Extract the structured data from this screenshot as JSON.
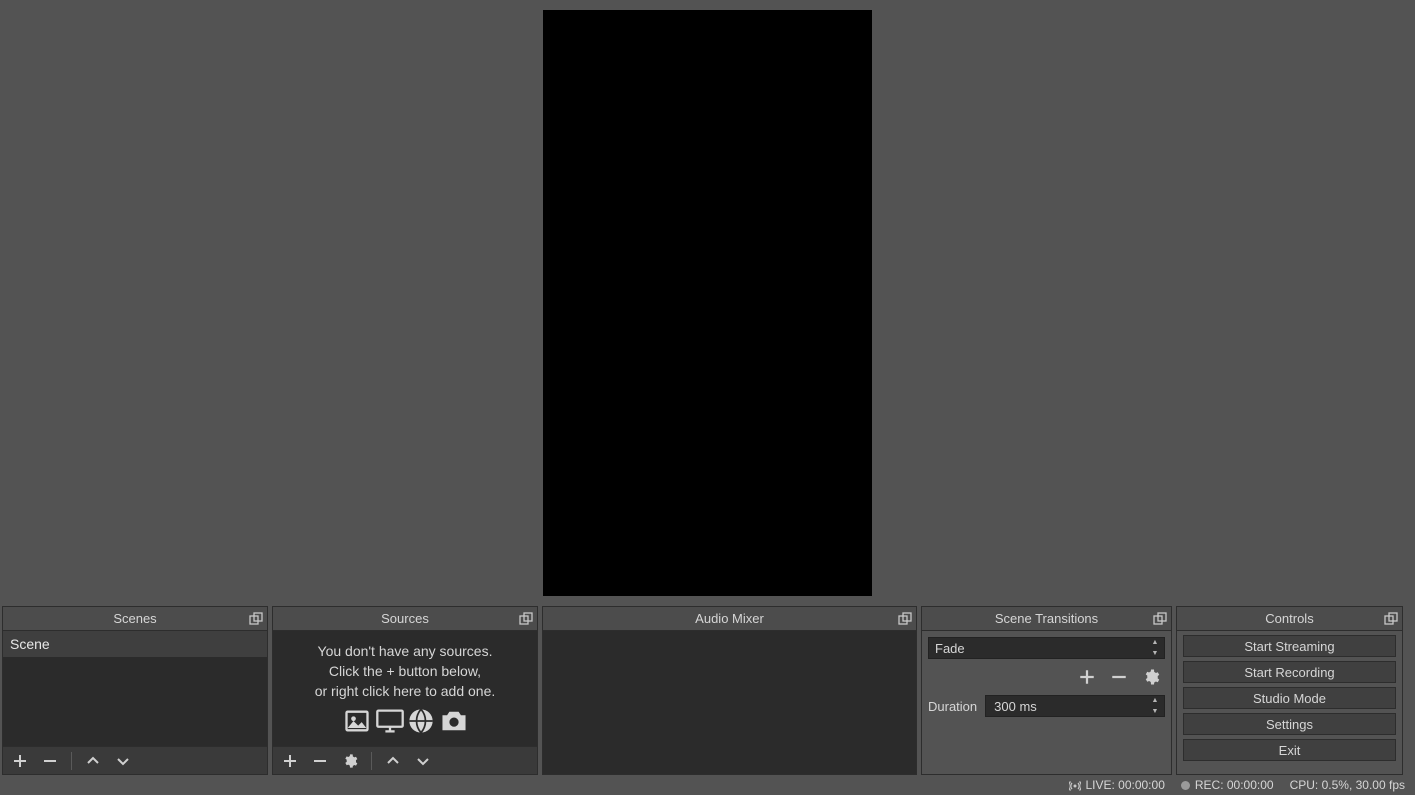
{
  "docks": {
    "scenes": {
      "title": "Scenes",
      "items": [
        "Scene"
      ]
    },
    "sources": {
      "title": "Sources",
      "empty_line1": "You don't have any sources.",
      "empty_line2": "Click the + button below,",
      "empty_line3": "or right click here to add one."
    },
    "mixer": {
      "title": "Audio Mixer"
    },
    "transitions": {
      "title": "Scene Transitions",
      "selected": "Fade",
      "duration_label": "Duration",
      "duration_value": "300 ms"
    },
    "controls": {
      "title": "Controls",
      "buttons": [
        "Start Streaming",
        "Start Recording",
        "Studio Mode",
        "Settings",
        "Exit"
      ]
    }
  },
  "statusbar": {
    "live": "LIVE: 00:00:00",
    "rec": "REC: 00:00:00",
    "cpu": "CPU: 0.5%, 30.00 fps"
  }
}
